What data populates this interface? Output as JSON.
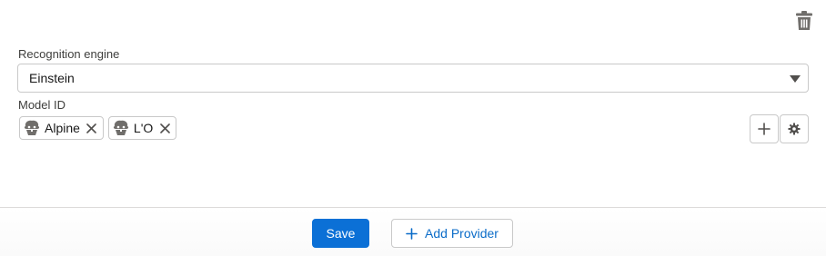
{
  "toolbar": {
    "delete_icon": "trash-icon"
  },
  "recognition_engine": {
    "label": "Recognition engine",
    "selected": "Einstein",
    "icon": "chevron-down-icon"
  },
  "model_id": {
    "label": "Model ID",
    "pills": [
      {
        "label": "Alpine",
        "icon": "einstein-avatar-icon"
      },
      {
        "label": "L'O",
        "icon": "einstein-avatar-icon"
      }
    ],
    "add_icon": "plus-icon",
    "settings_icon": "gear-icon"
  },
  "footer": {
    "save_label": "Save",
    "add_provider_label": "Add Provider"
  },
  "colors": {
    "brand": "#0b70d6",
    "border": "#c9c9c9",
    "icon": "#706e6b"
  }
}
